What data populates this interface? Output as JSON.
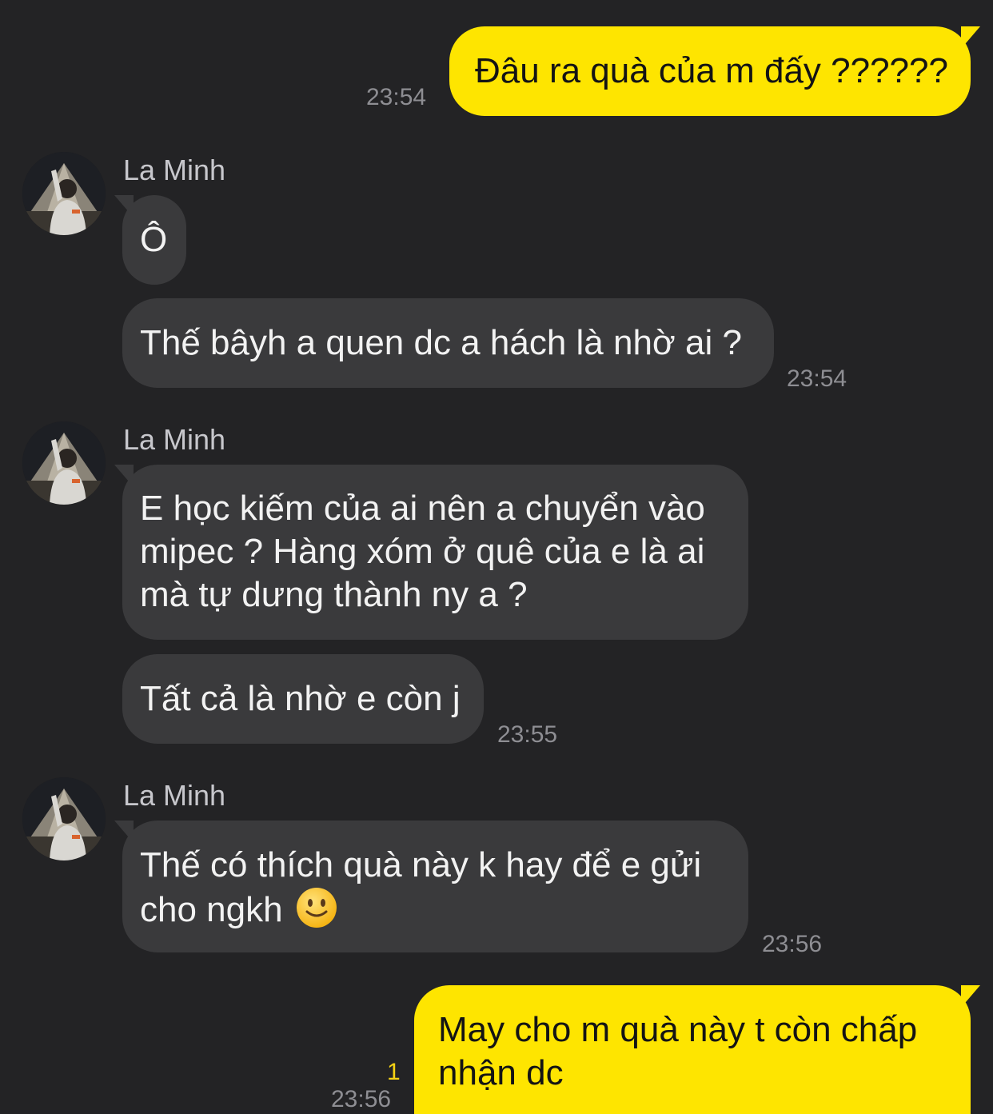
{
  "contact": {
    "name": "La Minh"
  },
  "messages": [
    {
      "from": "me",
      "text": "Đâu ra quà của m đấy ??????",
      "time": "23:54"
    },
    {
      "from": "other",
      "sender": "La Minh",
      "text": "Ô"
    },
    {
      "from": "other",
      "text": "Thế bâyh a quen dc a hách là nhờ ai ?",
      "time": "23:54"
    },
    {
      "from": "other",
      "sender": "La Minh",
      "text_lines": [
        "E học kiếm của ai nên a chuyển vào",
        "mipec ? Hàng xóm ở quê của e là ai",
        "mà tự dưng thành ny a ?"
      ]
    },
    {
      "from": "other",
      "text": "Tất cả là nhờ e còn j",
      "time": "23:55"
    },
    {
      "from": "other",
      "sender": "La Minh",
      "text_lines": [
        "Thế có thích quà này k hay để e gửi",
        "cho ngkh"
      ],
      "emoji": "slightly-smiling-face",
      "time": "23:56"
    },
    {
      "from": "me",
      "text_lines": [
        "May cho m quà này t còn chấp",
        "nhận dc"
      ],
      "time": "23:56",
      "unread": "1"
    }
  ],
  "colors": {
    "background": "#232325",
    "my_bubble": "#fee500",
    "other_bubble": "#3a3a3c",
    "timestamp": "#8e8e93",
    "unread": "#f5d214"
  }
}
